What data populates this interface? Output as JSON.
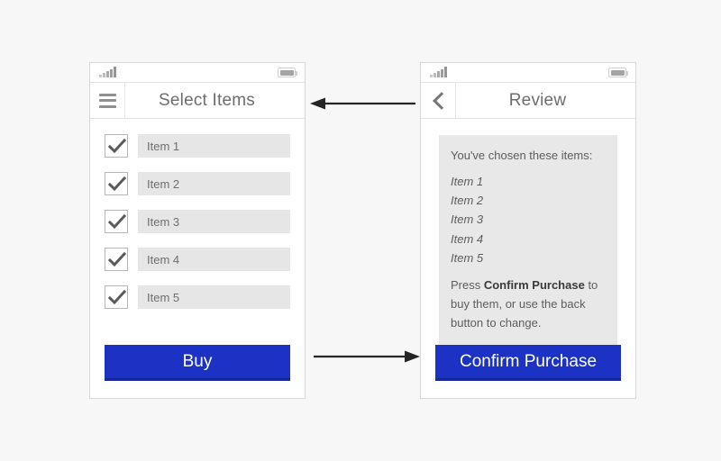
{
  "diagram": {
    "background_color": "#f7f7f7",
    "accent_color": "#1c32c4"
  },
  "screens": [
    {
      "id": "select-items",
      "statusbar": {
        "signal_icon": "signal-bars-icon",
        "battery_icon": "battery-icon"
      },
      "appbar": {
        "nav_icon": "hamburger-menu-icon",
        "title": "Select Items"
      },
      "items": [
        {
          "label": "Item 1",
          "checked": true
        },
        {
          "label": "Item 2",
          "checked": true
        },
        {
          "label": "Item 3",
          "checked": true
        },
        {
          "label": "Item 4",
          "checked": true
        },
        {
          "label": "Item 5",
          "checked": true
        }
      ],
      "primary_button": "Buy"
    },
    {
      "id": "review",
      "statusbar": {
        "signal_icon": "signal-bars-icon",
        "battery_icon": "battery-icon"
      },
      "appbar": {
        "nav_icon": "chevron-left-icon",
        "title": "Review"
      },
      "panel": {
        "lede": "You've chosen these items:",
        "items": [
          "Item 1",
          "Item 2",
          "Item 3",
          "Item 4",
          "Item 5"
        ],
        "instruction_prefix": "Press ",
        "instruction_emphasis": "Confirm Purchase",
        "instruction_suffix": " to buy them, or use the back button to change."
      },
      "primary_button": "Confirm Purchase"
    }
  ],
  "arrows": [
    {
      "id": "back-flow",
      "direction": "left"
    },
    {
      "id": "forward-flow",
      "direction": "right"
    }
  ]
}
